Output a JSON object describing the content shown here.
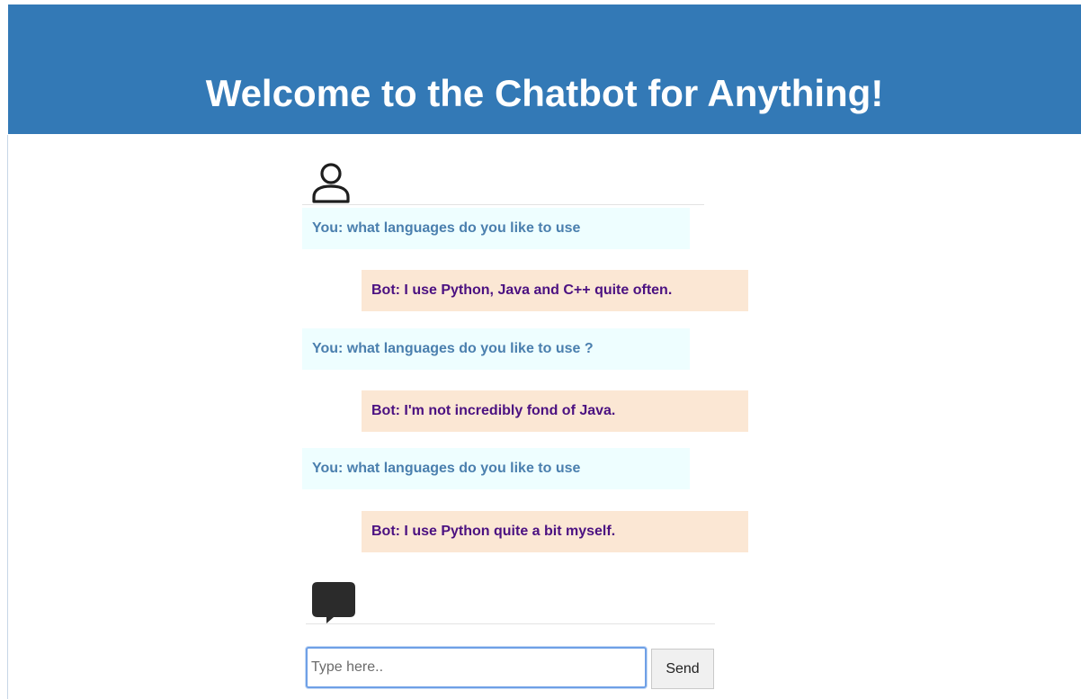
{
  "header": {
    "title": "Welcome to the Chatbot for Anything!"
  },
  "icons": {
    "user": "user-icon",
    "chat": "speech-bubble-icon"
  },
  "colors": {
    "header_bg": "#3379b6",
    "user_bubble_bg": "#eefeff",
    "user_text": "#4a7fae",
    "bot_bubble_bg": "#fbe7d4",
    "bot_text": "#4b1181"
  },
  "chat": {
    "messages": [
      {
        "sender": "user",
        "text": "You: what languages do you like to use"
      },
      {
        "sender": "bot",
        "text": "Bot: I use Python, Java and C++ quite often."
      },
      {
        "sender": "user",
        "text": "You: what languages do you like to use ?"
      },
      {
        "sender": "bot",
        "text": "Bot: I'm not incredibly fond of Java."
      },
      {
        "sender": "user",
        "text": "You: what languages do you like to use"
      },
      {
        "sender": "bot",
        "text": "Bot: I use Python quite a bit myself."
      }
    ]
  },
  "input": {
    "placeholder": "Type here..",
    "value": ""
  },
  "send_label": "Send"
}
